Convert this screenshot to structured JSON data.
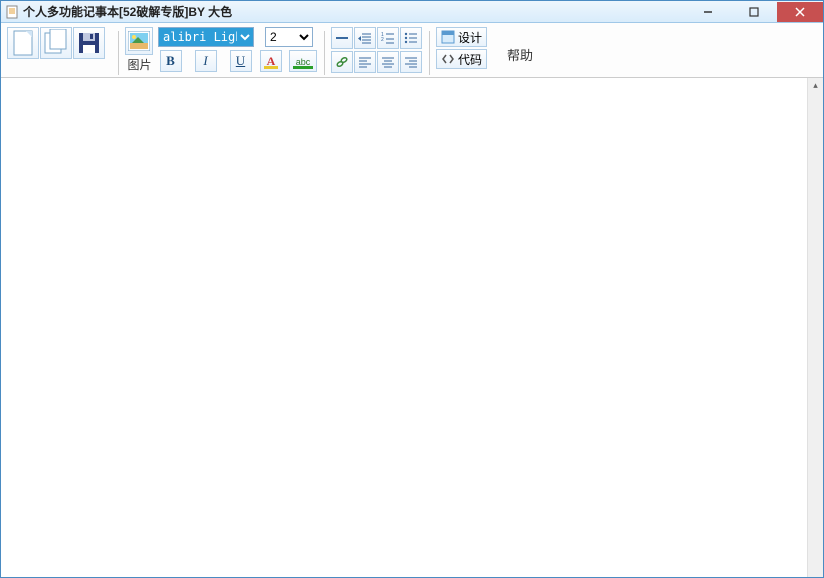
{
  "window": {
    "title": "个人多功能记事本[52破解专版]BY   大色"
  },
  "toolbar": {
    "image_label": "图片",
    "font_family": "alibri Light",
    "font_size": "2",
    "design_label": "设计",
    "code_label": "代码",
    "help_label": "帮助"
  },
  "icons": {
    "bold": "B",
    "italic": "I",
    "underline": "U",
    "font_color_text": "A",
    "highlight_text": "abc"
  }
}
